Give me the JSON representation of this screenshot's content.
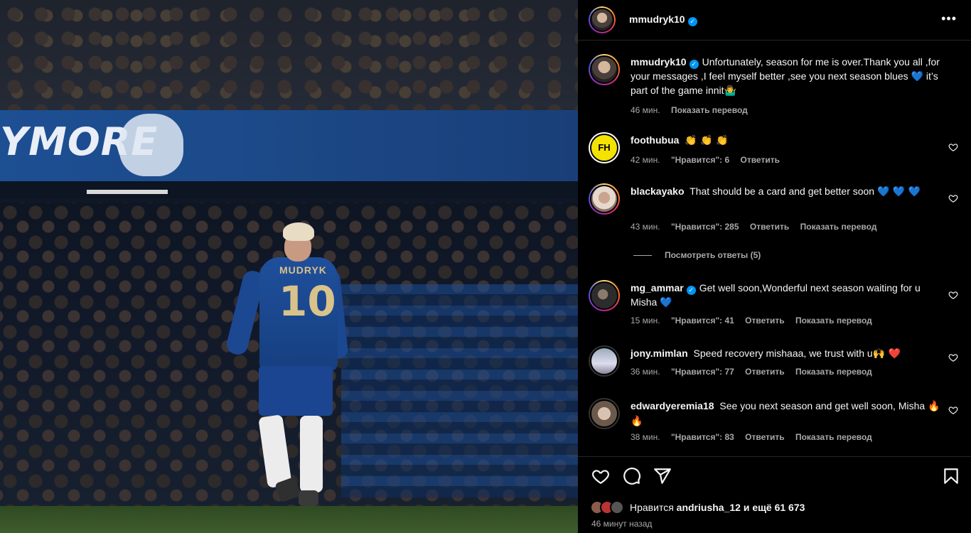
{
  "post": {
    "author": "mmudryk10",
    "more_label": "•••",
    "caption": {
      "text": "Unfortunately, season for me is over.Thank you all ,for your messages ,I feel myself better ,see you next season blues",
      "emoji_1": "💙",
      "text_2": "it’s part of the game innit",
      "emoji_2": "🤷‍♂️",
      "time": "46 мин.",
      "translate": "Показать перевод"
    },
    "photo": {
      "banner_text": "YMORE",
      "jersey_name": "MUDRYK",
      "jersey_number": "10"
    }
  },
  "comments": [
    {
      "username": "foothubua",
      "text": "",
      "emojis": "👏 👏 👏",
      "time": "42 мин.",
      "likes": "\"Нравится\": 6",
      "reply": "Ответить",
      "avatar_label": "FH",
      "avatar_color": "#f4e300"
    },
    {
      "username": "blackayako",
      "text": "That should be a card and get better soon",
      "emojis": "💙 💙 💙",
      "time": "43 мин.",
      "likes": "\"Нравится\": 285",
      "reply": "Ответить",
      "translate": "Показать перевод",
      "view_replies": "Посмотреть ответы (5)"
    },
    {
      "username": "mg_ammar",
      "text": "Get well soon,Wonderful next season waiting for u Misha",
      "emojis": "💙",
      "time": "15 мин.",
      "likes": "\"Нравится\": 41",
      "reply": "Ответить",
      "translate": "Показать перевод"
    },
    {
      "username": "jony.mimlan",
      "text": "Speed recovery mishaaa, we trust with u",
      "emojis": "🙌 ❤️",
      "time": "36 мин.",
      "likes": "\"Нравится\": 77",
      "reply": "Ответить",
      "translate": "Показать перевод"
    },
    {
      "username": "edwardyeremia18",
      "text": "See you next season and get well soon, Misha",
      "emojis": "🔥 🔥",
      "time": "38 мин.",
      "likes": "\"Нравится\": 83",
      "reply": "Ответить",
      "translate": "Показать перевод"
    }
  ],
  "footer": {
    "likes_prefix": "Нравится",
    "likes_user": "andriusha_12",
    "likes_suffix": "и ещё 61 673",
    "time_ago": "46 минут назад"
  },
  "colors": {
    "accent": "#0095f6",
    "text": "#f5f5f5",
    "muted": "#a8a8a8",
    "background": "#000000"
  }
}
